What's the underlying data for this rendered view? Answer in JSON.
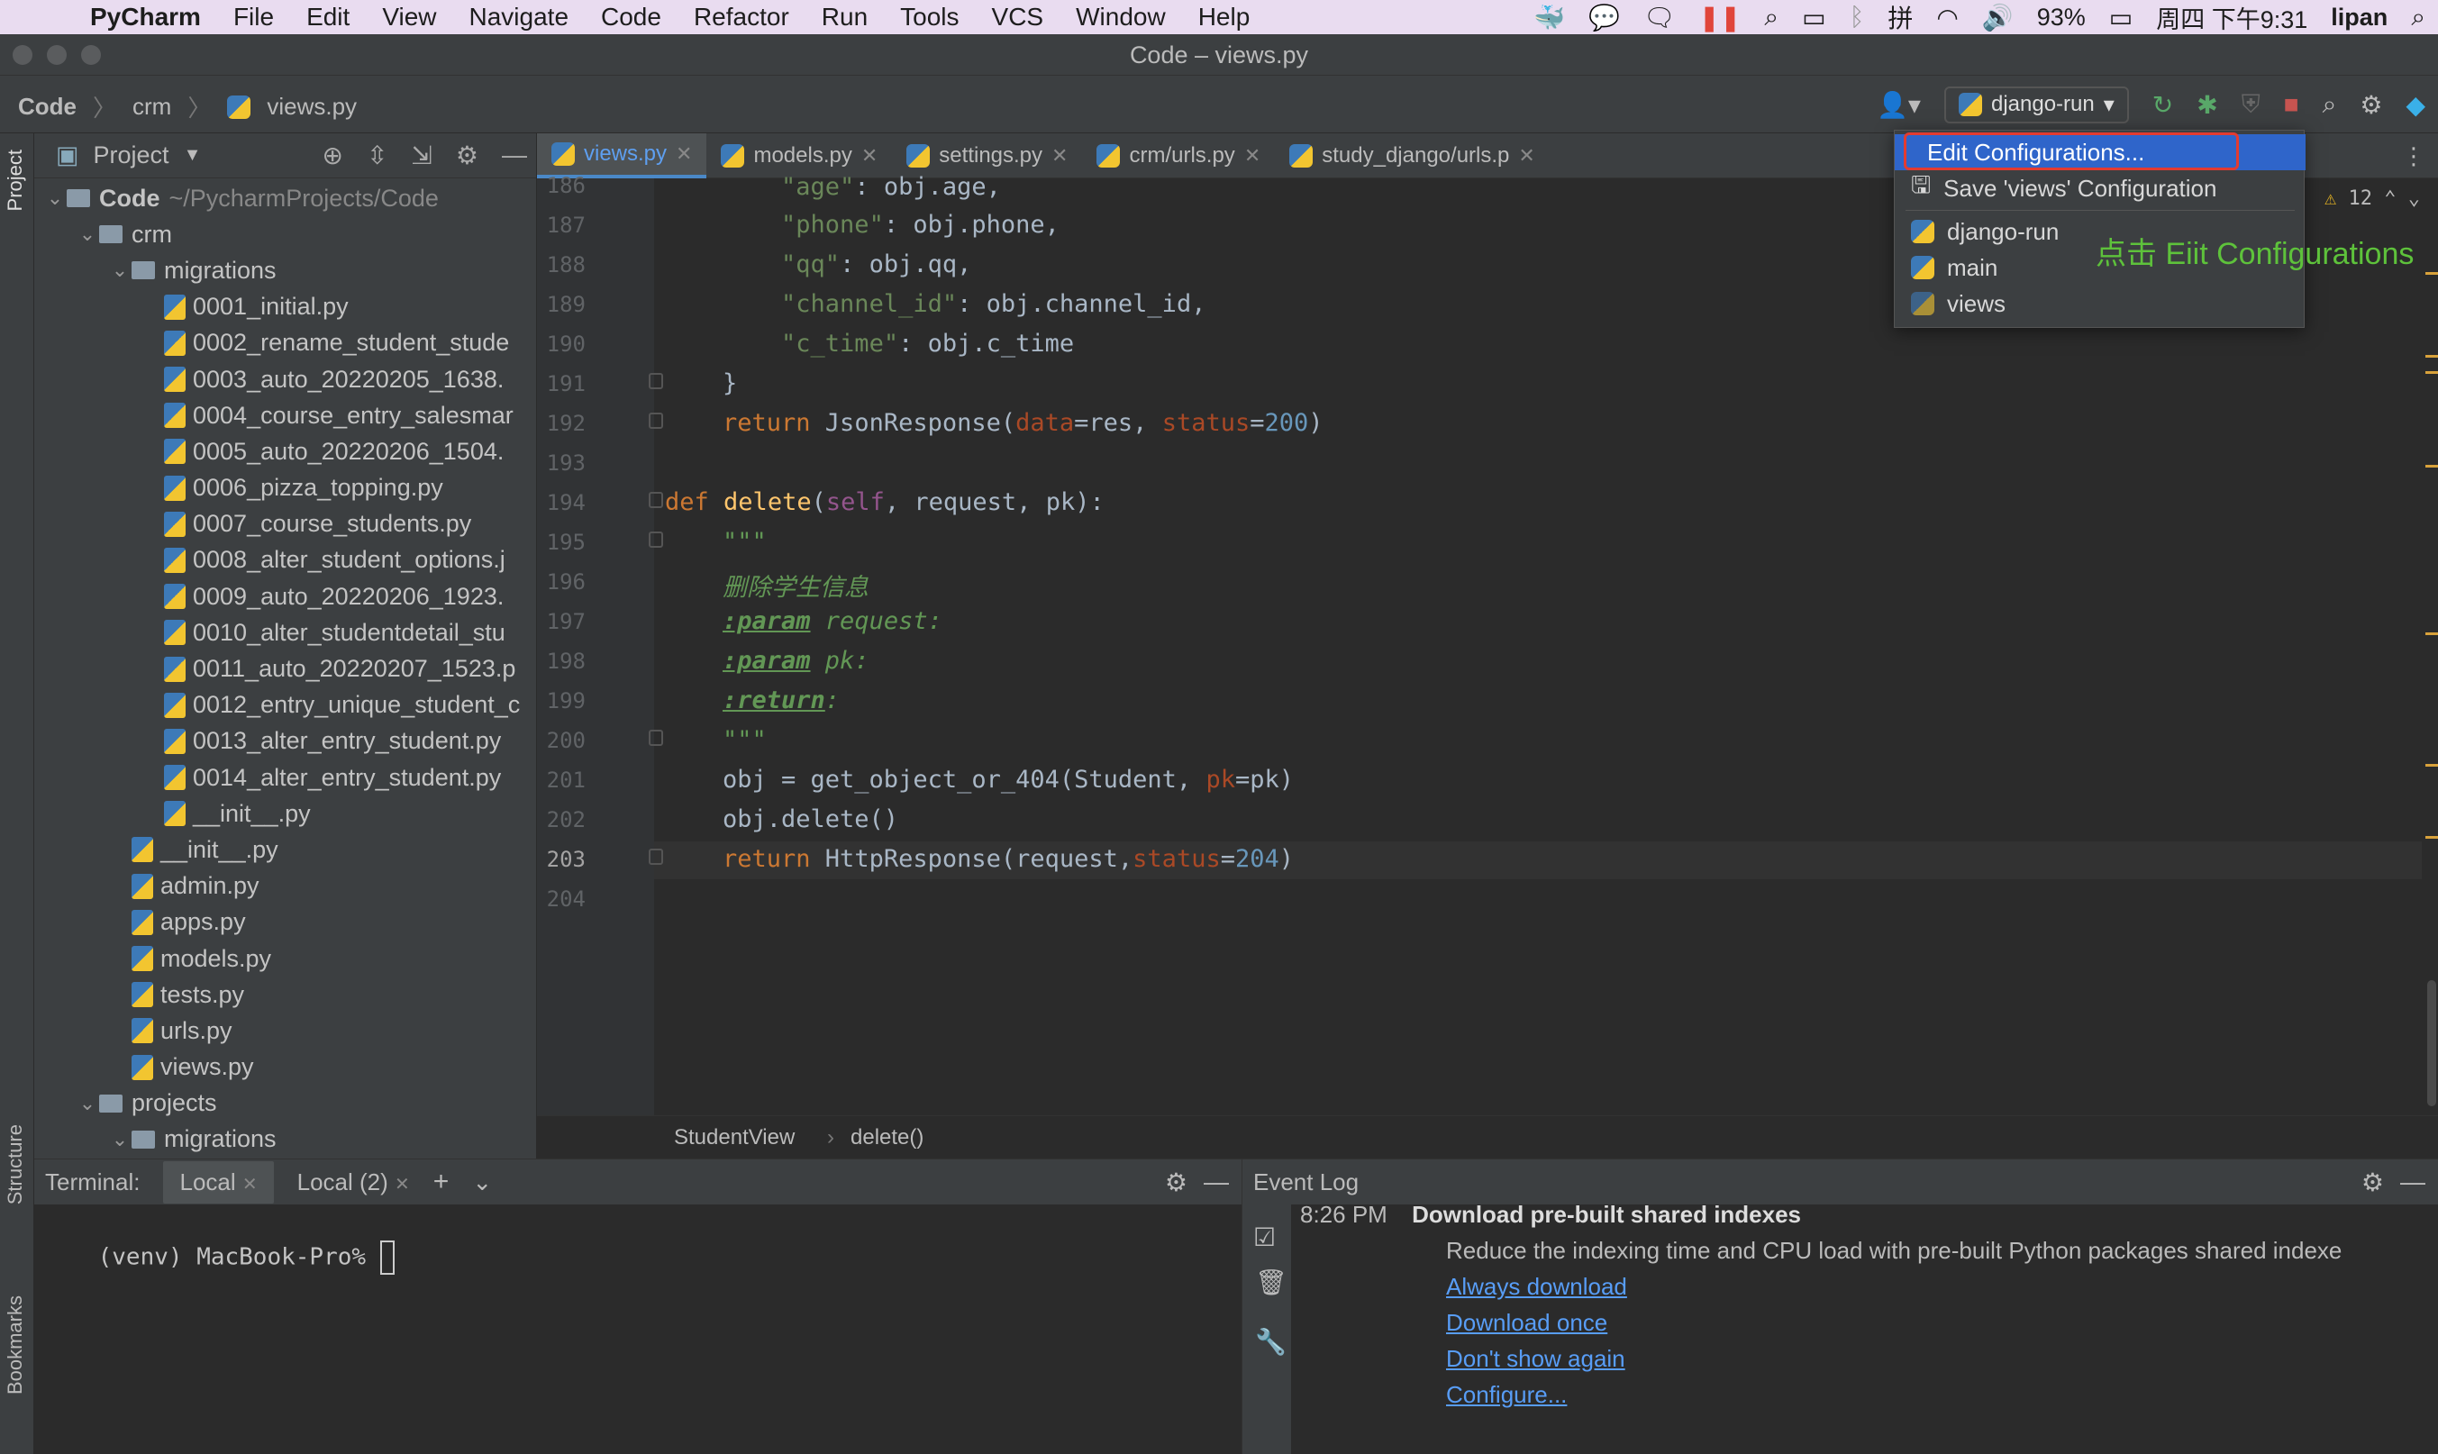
{
  "menubar": {
    "app": "PyCharm",
    "items": [
      "File",
      "Edit",
      "View",
      "Navigate",
      "Code",
      "Refactor",
      "Run",
      "Tools",
      "VCS",
      "Window",
      "Help"
    ],
    "battery": "93%",
    "clock": "周四 下午9:31",
    "user": "lipan"
  },
  "window": {
    "title": "Code – views.py"
  },
  "navbar": {
    "crumbs": [
      "Code",
      "crm",
      "views.py"
    ],
    "run_config": "django-run"
  },
  "project": {
    "title": "Project",
    "tree": [
      {
        "label": "Code",
        "extra": "~/PycharmProjects/Code",
        "depth": 0,
        "type": "folder",
        "open": true
      },
      {
        "label": "crm",
        "depth": 1,
        "type": "folder",
        "open": true
      },
      {
        "label": "migrations",
        "depth": 2,
        "type": "folder",
        "open": true
      },
      {
        "label": "0001_initial.py",
        "depth": 3,
        "type": "file"
      },
      {
        "label": "0002_rename_student_stude",
        "depth": 3,
        "type": "file"
      },
      {
        "label": "0003_auto_20220205_1638.",
        "depth": 3,
        "type": "file"
      },
      {
        "label": "0004_course_entry_salesmar",
        "depth": 3,
        "type": "file"
      },
      {
        "label": "0005_auto_20220206_1504.",
        "depth": 3,
        "type": "file"
      },
      {
        "label": "0006_pizza_topping.py",
        "depth": 3,
        "type": "file"
      },
      {
        "label": "0007_course_students.py",
        "depth": 3,
        "type": "file"
      },
      {
        "label": "0008_alter_student_options.j",
        "depth": 3,
        "type": "file"
      },
      {
        "label": "0009_auto_20220206_1923.",
        "depth": 3,
        "type": "file"
      },
      {
        "label": "0010_alter_studentdetail_stu",
        "depth": 3,
        "type": "file"
      },
      {
        "label": "0011_auto_20220207_1523.p",
        "depth": 3,
        "type": "file"
      },
      {
        "label": "0012_entry_unique_student_c",
        "depth": 3,
        "type": "file"
      },
      {
        "label": "0013_alter_entry_student.py",
        "depth": 3,
        "type": "file"
      },
      {
        "label": "0014_alter_entry_student.py",
        "depth": 3,
        "type": "file"
      },
      {
        "label": "__init__.py",
        "depth": 3,
        "type": "file"
      },
      {
        "label": "__init__.py",
        "depth": 2,
        "type": "file"
      },
      {
        "label": "admin.py",
        "depth": 2,
        "type": "file"
      },
      {
        "label": "apps.py",
        "depth": 2,
        "type": "file"
      },
      {
        "label": "models.py",
        "depth": 2,
        "type": "file"
      },
      {
        "label": "tests.py",
        "depth": 2,
        "type": "file"
      },
      {
        "label": "urls.py",
        "depth": 2,
        "type": "file"
      },
      {
        "label": "views.py",
        "depth": 2,
        "type": "file"
      },
      {
        "label": "projects",
        "depth": 1,
        "type": "folder",
        "open": true
      },
      {
        "label": "migrations",
        "depth": 2,
        "type": "folder",
        "open": true
      }
    ]
  },
  "tabs": [
    "views.py",
    "models.py",
    "settings.py",
    "crm/urls.py",
    "study_django/urls.p"
  ],
  "editor": {
    "line_numbers": [
      "186",
      "187",
      "188",
      "189",
      "190",
      "191",
      "192",
      "193",
      "194",
      "195",
      "196",
      "197",
      "198",
      "199",
      "200",
      "201",
      "202",
      "203",
      "204"
    ],
    "current_line": "203",
    "warnings": "12"
  },
  "editor_breadcrumb": [
    "StudentView",
    "delete()"
  ],
  "terminal": {
    "label": "Terminal:",
    "tabs": [
      "Local",
      "Local (2)"
    ],
    "prompt": "(venv) MacBook-Pro% "
  },
  "event_log": {
    "title": "Event Log",
    "time": "8:26 PM",
    "heading": "Download pre-built shared indexes",
    "message": "Reduce the indexing time and CPU load with pre-built Python packages shared indexe",
    "links": [
      "Always download",
      "Download once",
      "Don't show again",
      "Configure..."
    ]
  },
  "popup": {
    "edit": "Edit Configurations...",
    "save": "Save 'views' Configuration",
    "configs": [
      "django-run",
      "main",
      "views"
    ]
  },
  "annotation": "点击 Eiit Configurations",
  "colors": {
    "accent": "#2f65ca",
    "highlight_box": "#e33b30",
    "annotation": "#5ec23b"
  }
}
